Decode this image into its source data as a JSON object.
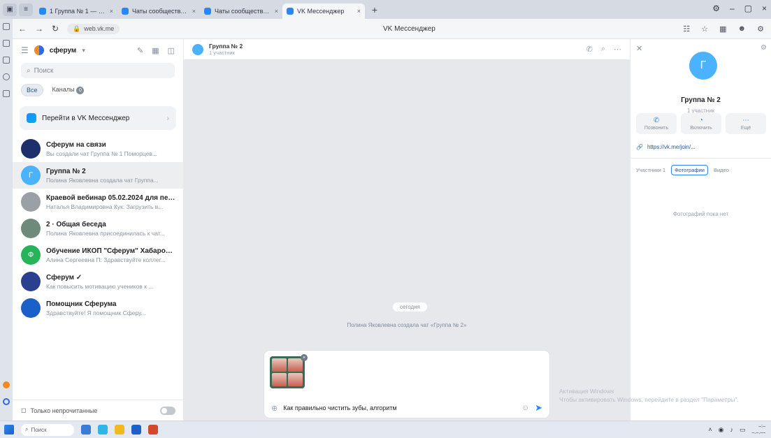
{
  "browser": {
    "tabs": [
      {
        "label": "1 Группа № 1 — Сферу",
        "active": false
      },
      {
        "label": "Чаты сообщества — Сфе",
        "active": false
      },
      {
        "label": "Чаты сообщества — Сфе",
        "active": false
      },
      {
        "label": "VK Мессенджер",
        "active": true
      }
    ],
    "url": "web.vk.me",
    "page_title": "VK Мессенджер"
  },
  "sidebar": {
    "org_name": "сферум",
    "search_placeholder": "Поиск",
    "filters": [
      {
        "label": "Все",
        "active": true
      },
      {
        "label": "Каналы",
        "count": "0",
        "active": false
      }
    ],
    "promo": "Перейти в VK Мессенджер",
    "chats": [
      {
        "name": "Сферум на связи",
        "preview": "Вы создали чат Группа № 1 Поморцев...",
        "avatar_color": "#1f2f6b",
        "avatar_text": "",
        "selected": false
      },
      {
        "name": "Группа № 2",
        "preview": "Полина Яковлевна создала чат Группа...",
        "avatar_color": "#4bb3fd",
        "avatar_text": "Г",
        "selected": true
      },
      {
        "name": "Краевой вебинар 05.02.2024 для педагог...",
        "preview": "Наталья Владимировна Кук: Загрузить в...",
        "avatar_color": "#9aa0a6",
        "avatar_text": "",
        "selected": false
      },
      {
        "name": "2 · Общая беседа",
        "preview": "Полина Яковлевна присоединилась к чат...",
        "avatar_color": "#6d8a7a",
        "avatar_text": "",
        "selected": false
      },
      {
        "name": "Обучение ИКОП \"Сферум\" Хабаровский к...",
        "preview": "Алина Сергеевна П: Здравствуйте коллег...",
        "avatar_color": "#27b35a",
        "avatar_text": "Ф",
        "selected": false
      },
      {
        "name": "Сферум ✓",
        "preview": "Как повысить мотивацию учеников к ...",
        "avatar_color": "#2a3f8f",
        "avatar_text": "",
        "selected": false
      },
      {
        "name": "Помощник Сферума",
        "preview": "Здравствуйте! Я помощник Сферу...",
        "avatar_color": "#1b5fc9",
        "avatar_text": "",
        "selected": false
      }
    ],
    "footer_label": "Только непрочитанные"
  },
  "conversation": {
    "title": "Группа № 2",
    "subtitle": "1 участник",
    "date_label": "сегодня",
    "system_message": "Полина Яковлевна создала чат «Группа № 2»",
    "draft_text": "Как правильно чистить зубы, алгоритм"
  },
  "info_panel": {
    "avatar_letter": "Г",
    "name": "Группа № 2",
    "subtitle": "1 участник",
    "actions": [
      {
        "icon": "phone-icon",
        "glyph": "✆",
        "label": "Позвонить"
      },
      {
        "icon": "bell-icon",
        "glyph": "◔",
        "label": "Включить"
      },
      {
        "icon": "more-icon",
        "glyph": "⋯",
        "label": "Ещё"
      }
    ],
    "invite_link": "https://vk.me/join/...",
    "tabs": [
      {
        "label": "Участники 1",
        "active": false
      },
      {
        "label": "Фотографии",
        "active": true
      },
      {
        "label": "Видео",
        "active": false
      }
    ],
    "empty_text": "Фотографий пока нет"
  },
  "watermark": {
    "line1": "Активация Windows",
    "line2": "Чтобы активировать Windows, перейдите в раздел \"Параметры\"."
  },
  "taskbar": {
    "search_label": "Поиск"
  }
}
